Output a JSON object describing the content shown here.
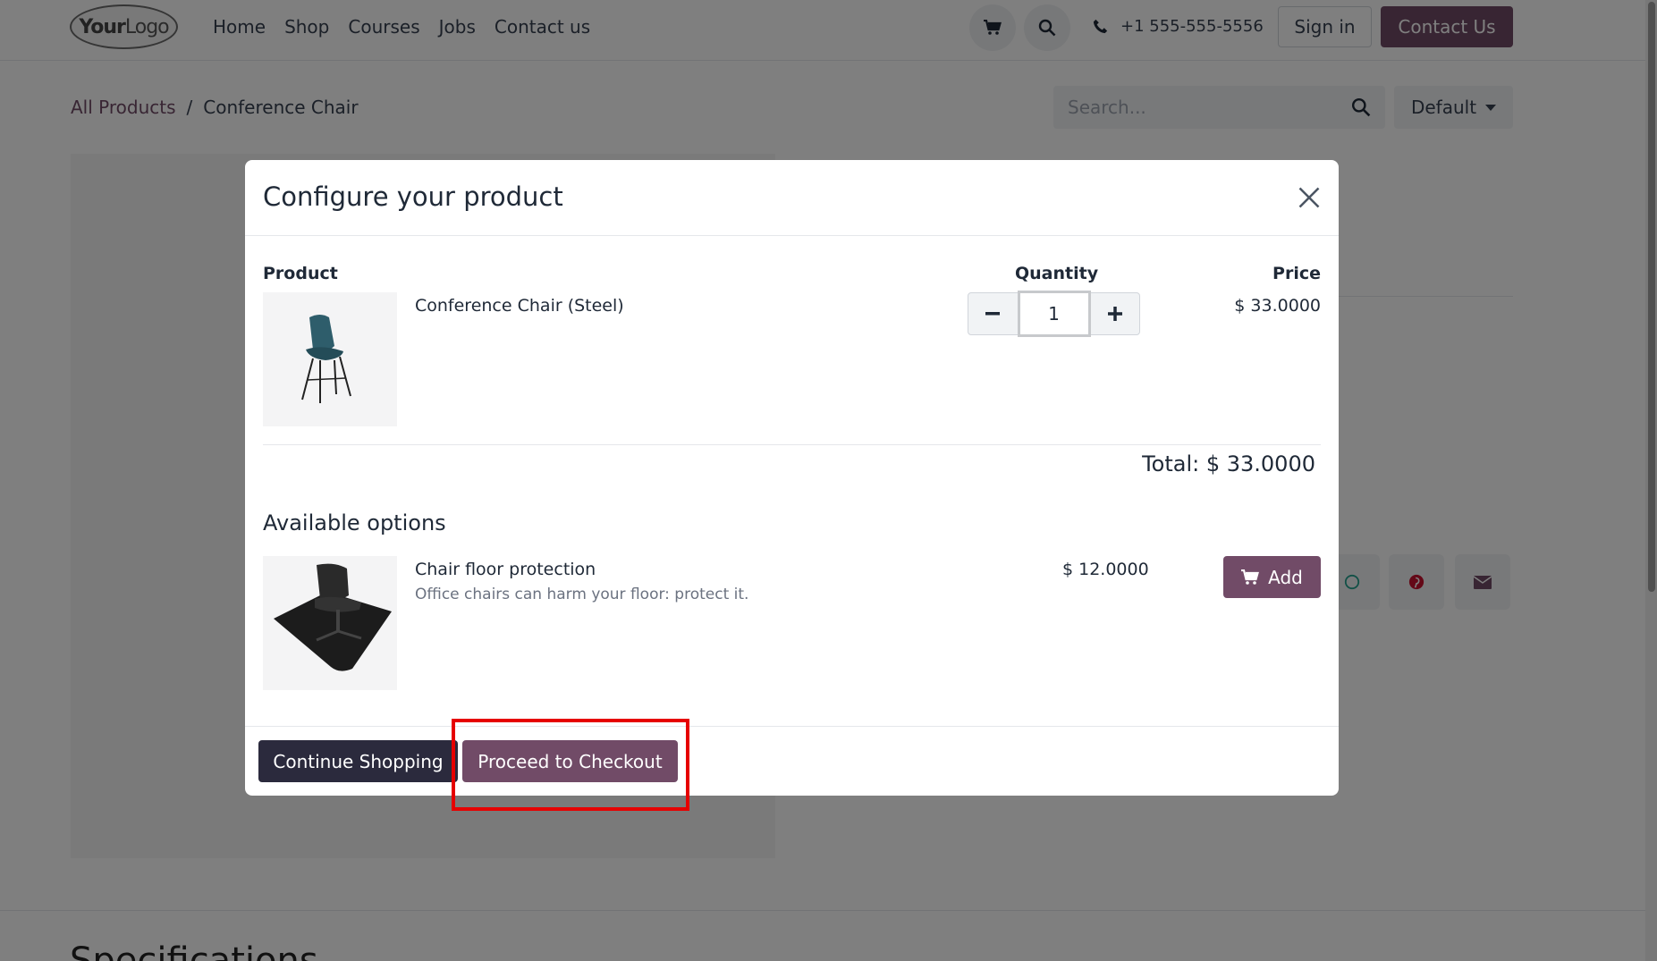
{
  "header": {
    "logo_text_bold": "Your",
    "logo_text_light": "Logo",
    "nav": [
      "Home",
      "Shop",
      "Courses",
      "Jobs",
      "Contact us"
    ],
    "phone": "+1 555-555-5556",
    "sign_in": "Sign in",
    "contact_us": "Contact Us"
  },
  "breadcrumb": {
    "parent": "All Products",
    "separator": "/",
    "current": "Conference Chair"
  },
  "search": {
    "placeholder": "Search..."
  },
  "sort": {
    "selected": "Default"
  },
  "specification_heading": "Specifications",
  "modal": {
    "title": "Configure your product",
    "columns": {
      "product": "Product",
      "quantity": "Quantity",
      "price": "Price"
    },
    "product": {
      "name": "Conference Chair (Steel)",
      "quantity": "1",
      "price": "$ 33.0000"
    },
    "total_label": "Total: $ 33.0000",
    "options_title": "Available options",
    "option": {
      "name": "Chair floor protection",
      "description": "Office chairs can harm your floor: protect it.",
      "price": "$ 12.0000",
      "add_label": "Add"
    },
    "continue_label": "Continue Shopping",
    "checkout_label": "Proceed to Checkout"
  },
  "colors": {
    "brand": "#714B67",
    "dark_button": "#2b2a3d",
    "highlight": "#e60000"
  }
}
